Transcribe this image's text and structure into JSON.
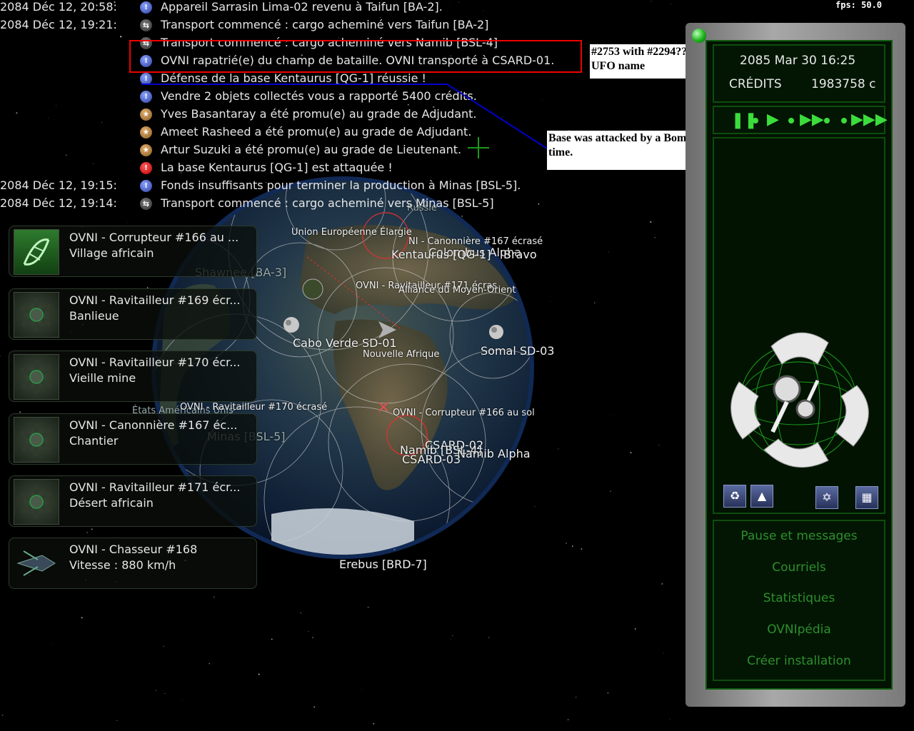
{
  "fps": "fps: 50.0",
  "messages": [
    {
      "time": "2084 Déc 12, 20:58:",
      "icon": "info",
      "text": "Appareil Sarrasin Lima-02 revenu à Taifun [BA-2]."
    },
    {
      "time": "2084 Déc 12, 19:21:",
      "icon": "transport",
      "text": "Transport commencé : cargo acheminé vers Taifun [BA-2]"
    },
    {
      "time": "",
      "icon": "transport",
      "text": "Transport commencé : cargo acheminé vers Namib [BSL-4]"
    },
    {
      "time": "",
      "icon": "info",
      "text": "OVNI rapatrié(e) du champ de bataille. OVNI transporté à CSARD-01."
    },
    {
      "time": "",
      "icon": "info",
      "text": "Défense de la base Kentaurus [QG-1] réussie !"
    },
    {
      "time": "",
      "icon": "info",
      "text": "Vendre 2 objets collectés vous a rapporté 5400 crédits."
    },
    {
      "time": "",
      "icon": "promo",
      "text": "Yves Basantaray a été promu(e) au grade de Adjudant."
    },
    {
      "time": "",
      "icon": "promo",
      "text": "Ameet Rasheed a été promu(e) au grade de Adjudant."
    },
    {
      "time": "",
      "icon": "promo",
      "text": "Artur Suzuki a été promu(e) au grade de Lieutenant."
    },
    {
      "time": "",
      "icon": "alert",
      "text": "La base Kentaurus [QG-1] est attaquée !"
    },
    {
      "time": "2084 Déc 12, 19:15:",
      "icon": "info",
      "text": "Fonds insuffisants pour terminer la production à Minas [BSL-5]."
    },
    {
      "time": "2084 Déc 12, 19:14:",
      "icon": "transport",
      "text": "Transport commencé : cargo acheminé vers Minas [BSL-5]"
    }
  ],
  "annotations": {
    "note1": "#2753 with #2294?? UFO name",
    "note2": "Base was attacked by a Bomber, a not yet researched UFO at this time."
  },
  "ufos": [
    {
      "title": "OVNI - Corrupteur #166 au ...",
      "sub": "Village africain",
      "thumb": "dna-icon"
    },
    {
      "title": "OVNI - Ravitailleur #169 écr...",
      "sub": "Banlieue",
      "thumb": "ufo-wreck-icon"
    },
    {
      "title": "OVNI - Ravitailleur #170 écr...",
      "sub": "Vieille mine",
      "thumb": "ufo-wreck-icon"
    },
    {
      "title": "OVNI - Canonnière #167 éc...",
      "sub": "Chantier",
      "thumb": "ufo-wreck-icon"
    },
    {
      "title": "OVNI - Ravitailleur #171 écr...",
      "sub": "Désert africain",
      "thumb": "ufo-wreck-icon"
    },
    {
      "title": "OVNI - Chasseur #168",
      "sub": "Vitesse : 880 km/h",
      "thumb": "fighter-icon"
    }
  ],
  "map_labels": [
    "Russie",
    "Union Européenne Élargie",
    "NI - Canonnière #167 écrasé",
    "Colombus Alpha",
    "Kentaurus [QG-1]",
    "Bravo",
    "Shawnee [BA-3]",
    "OVNI - Ravitailleur #171 écras",
    "Alliance du Moyen-Orient",
    "Cabo Verde SD-01",
    "Nouvelle Afrique",
    "Somal SD-03",
    "États Américains Unis",
    "OVNI - Ravitailleur #170 écrasé",
    "OVNI - Corrupteur #166 au sol",
    "Minas [BSL-5]",
    "CSARD-02",
    "Namib [BSL-4]",
    "Namib Alpha",
    "CSARD-03",
    "Erebus [BRD-7]"
  ],
  "panel": {
    "date": "2085 Mar 30 16:25",
    "credits_label": "CRÉDITS",
    "credits_value": "1983758 c",
    "menu": [
      "Pause et messages",
      "Courriels",
      "Statistiques",
      "OVNIpédia",
      "Créer installation"
    ]
  },
  "colors": {
    "accent_green": "#3cdc3c",
    "menu_green": "#2d8f2d",
    "annotation_red": "#e00000",
    "annotation_blue": "#0000cc"
  }
}
